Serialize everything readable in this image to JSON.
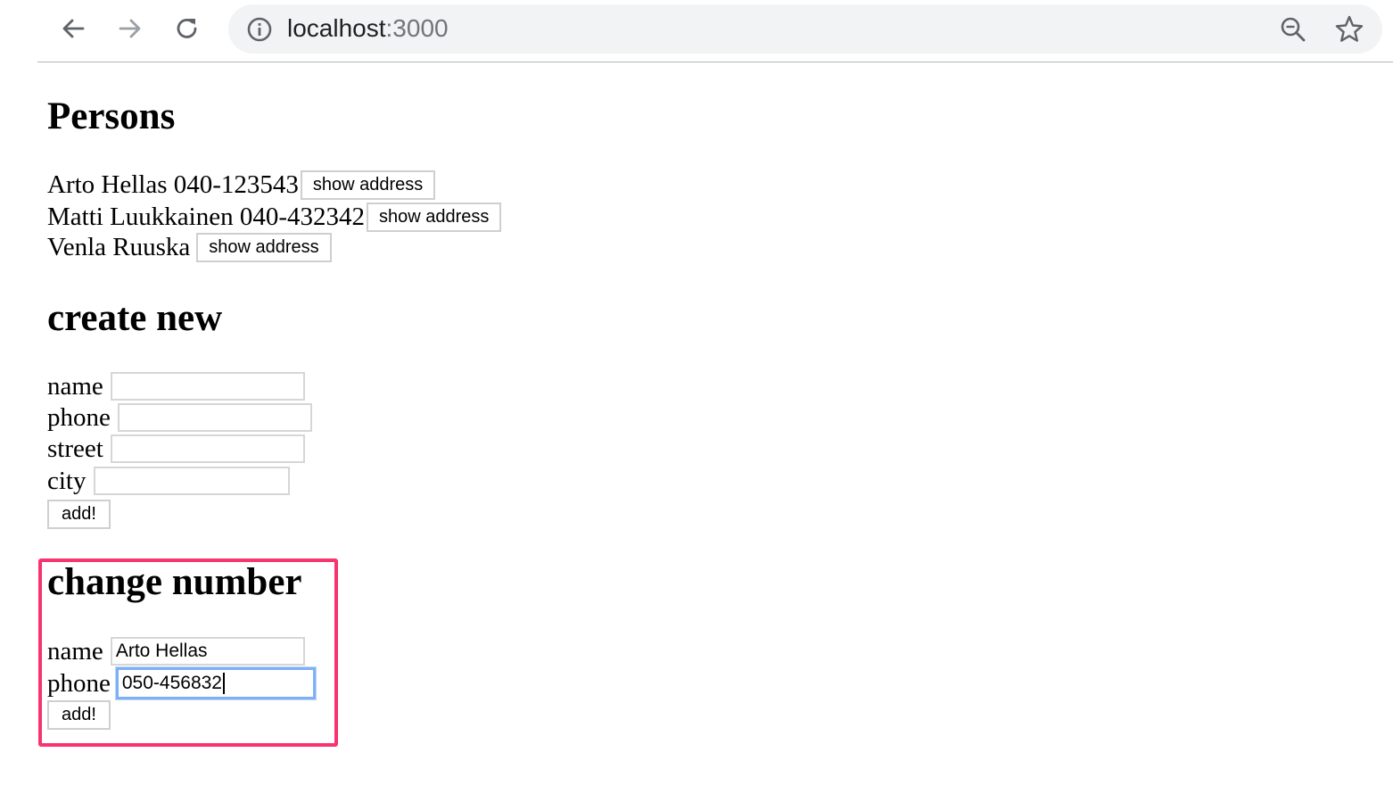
{
  "browser": {
    "url_host": "localhost",
    "url_port": ":3000",
    "icons": [
      "back-arrow-icon",
      "forward-arrow-icon",
      "reload-icon",
      "info-icon",
      "zoom-out-icon",
      "bookmark-star-icon"
    ]
  },
  "persons_section": {
    "title": "Persons",
    "persons": [
      {
        "text": "Arto Hellas 040-123543",
        "button": "show address"
      },
      {
        "text": "Matti Luukkainen 040-432342",
        "button": "show address"
      },
      {
        "text": "Venla Ruuska",
        "button": "show address"
      }
    ]
  },
  "create_section": {
    "title": "create new",
    "fields": [
      {
        "label": "name",
        "value": ""
      },
      {
        "label": "phone",
        "value": ""
      },
      {
        "label": "street",
        "value": ""
      },
      {
        "label": "city",
        "value": ""
      }
    ],
    "submit": "add!"
  },
  "change_section": {
    "title": "change number",
    "fields": [
      {
        "label": "name",
        "value": "Arto Hellas"
      },
      {
        "label": "phone",
        "value": "050-456832"
      }
    ],
    "submit": "add!",
    "highlight_color": "#f8336e"
  }
}
